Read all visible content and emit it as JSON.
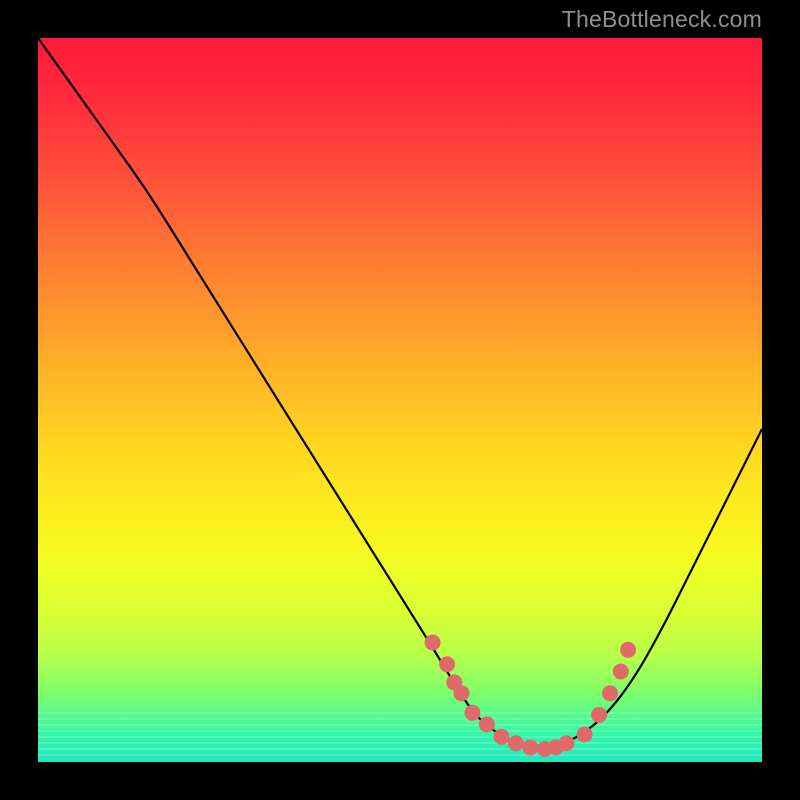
{
  "attribution": "TheBottleneck.com",
  "chart_data": {
    "type": "line",
    "title": "",
    "xlabel": "",
    "ylabel": "",
    "xlim": [
      0,
      100
    ],
    "ylim": [
      0,
      100
    ],
    "grid": false,
    "legend": false,
    "series": [
      {
        "name": "curve",
        "x": [
          0,
          5,
          10,
          15,
          20,
          25,
          30,
          35,
          40,
          45,
          50,
          55,
          58,
          60,
          62,
          65,
          68,
          70,
          74,
          78,
          82,
          86,
          90,
          95,
          100
        ],
        "y": [
          100,
          93,
          86,
          79,
          71,
          63,
          55,
          47,
          39,
          31,
          23,
          15,
          10,
          7,
          5,
          3,
          2,
          2,
          3,
          6,
          11,
          18,
          26,
          36,
          46
        ]
      }
    ],
    "markers": {
      "name": "dots",
      "x": [
        54.5,
        56.5,
        57.5,
        58.5,
        60,
        62,
        64,
        66,
        68,
        70,
        71.5,
        73,
        75.5,
        77.5,
        79,
        80.5,
        81.5
      ],
      "y": [
        16.5,
        13.5,
        11,
        9.5,
        6.8,
        5.2,
        3.5,
        2.6,
        2.0,
        1.8,
        2.0,
        2.6,
        3.8,
        6.5,
        9.5,
        12.5,
        15.5
      ]
    },
    "background_gradient": {
      "top": "#ff1a3a",
      "bottom": "#1fe9be"
    }
  },
  "axes": {
    "x_label_hidden": "",
    "y_label_hidden": ""
  }
}
